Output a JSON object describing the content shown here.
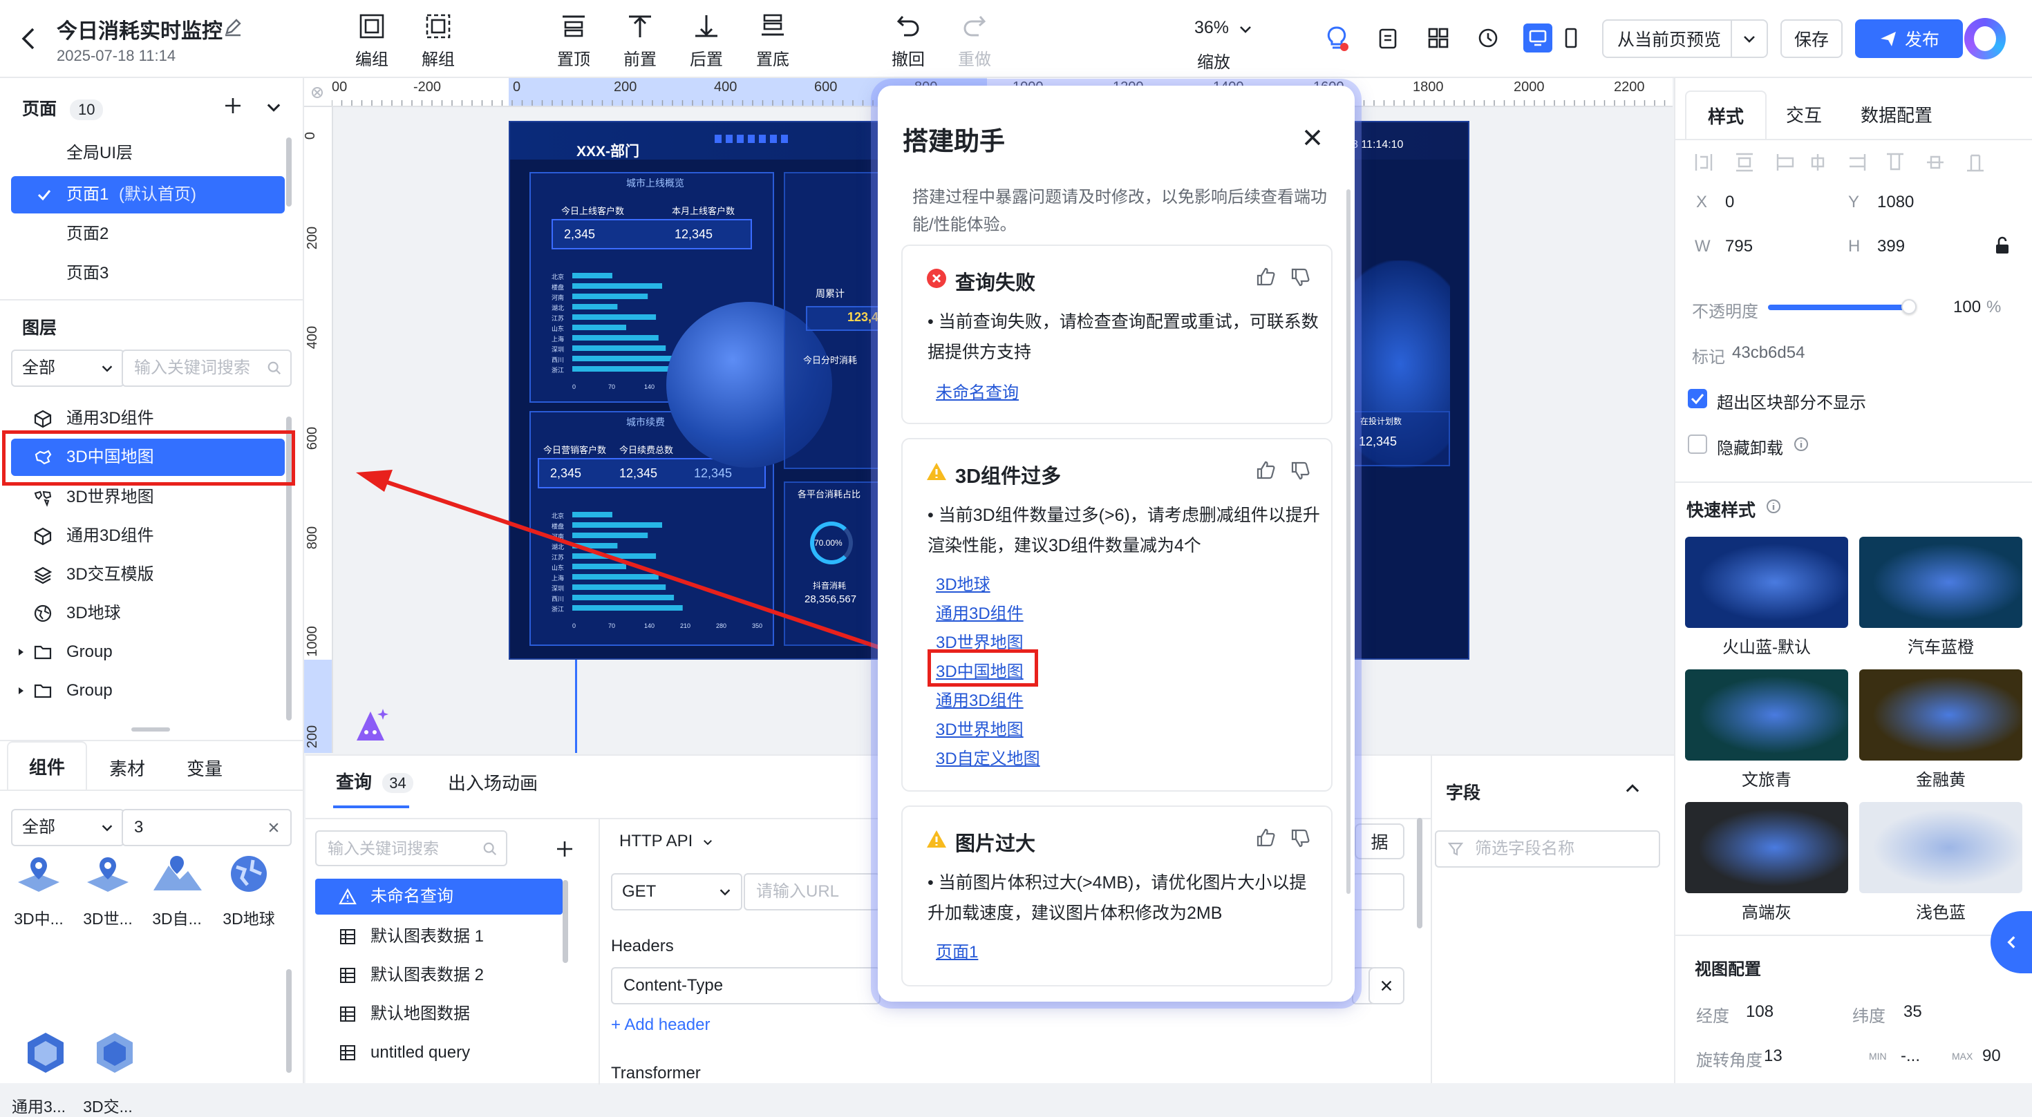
{
  "header": {
    "title": "今日消耗实时监控",
    "timestamp": "2025-07-18 11:14",
    "toolbar": [
      {
        "id": "group",
        "label": "编组"
      },
      {
        "id": "ungroup",
        "label": "解组"
      },
      {
        "id": "top",
        "label": "置顶"
      },
      {
        "id": "forward",
        "label": "前置"
      },
      {
        "id": "backward",
        "label": "后置"
      },
      {
        "id": "bottom",
        "label": "置底"
      },
      {
        "id": "undo",
        "label": "撤回"
      },
      {
        "id": "redo",
        "label": "重做"
      }
    ],
    "zoom": {
      "value": "36%",
      "label": "缩放"
    },
    "preview_label": "从当前页预览",
    "save_label": "保存",
    "publish_label": "发布"
  },
  "pages": {
    "title": "页面",
    "count": "10",
    "items": [
      {
        "label": "全局UI层"
      },
      {
        "label": "页面1",
        "suffix": "(默认首页)"
      },
      {
        "label": "页面2"
      },
      {
        "label": "页面3"
      }
    ]
  },
  "layers": {
    "title": "图层",
    "filter": "全部",
    "search_placeholder": "输入关键词搜索",
    "items": [
      {
        "label": "通用3D组件",
        "icon": "cube-icon"
      },
      {
        "label": "3D中国地图",
        "icon": "china-map-icon"
      },
      {
        "label": "3D世界地图",
        "icon": "world-map-icon"
      },
      {
        "label": "通用3D组件",
        "icon": "cube-icon"
      },
      {
        "label": "3D交互模版",
        "icon": "layers-icon"
      },
      {
        "label": "3D地球",
        "icon": "globe-icon"
      },
      {
        "label": "Group",
        "icon": "folder-icon"
      },
      {
        "label": "Group",
        "icon": "folder-icon"
      }
    ]
  },
  "bottom_tabs": {
    "components": "组件",
    "assets": "素材",
    "variables": "变量",
    "filter": "全部",
    "search_value": "3",
    "items": [
      {
        "label": "3D中..."
      },
      {
        "label": "3D世..."
      },
      {
        "label": "3D自..."
      },
      {
        "label": "3D地球"
      },
      {
        "label": "通用3..."
      },
      {
        "label": "3D交..."
      }
    ]
  },
  "rulers": {
    "h": [
      "-200",
      "0",
      "200",
      "400",
      "600",
      "800",
      "1000",
      "1200",
      "1400",
      "1600",
      "1800",
      "2000",
      "2200"
    ],
    "h_first": "00",
    "v": [
      "0",
      "200",
      "400",
      "600",
      "800",
      "1000",
      "200"
    ]
  },
  "dashboard": {
    "dept": "XXX-部门",
    "time": "8 11:14:10",
    "panel1_title": "城市上线概览",
    "today_new": "今日上线客户数",
    "month_new": "本月上线客户数",
    "today_val": "2,345",
    "month_val": "12,345",
    "panel2_title": "城市续费",
    "p2_a": "今日营销客户数",
    "p2_b": "今日续费总数",
    "p2_v1": "2,345",
    "p2_v2": "12,345",
    "p2_v3": "12,345",
    "week": "周累计",
    "week_val": "123,45",
    "minute": "今日分时消耗",
    "share": "各平台消耗占比",
    "pct": "70.00%",
    "douyin": "抖音消耗",
    "douyin_val": "28,356,567",
    "invest": "在投计划数",
    "invest_val": "12,345",
    "cities": [
      "北京",
      "楼盘",
      "河南",
      "湖北",
      "江苏",
      "山东",
      "上海",
      "深圳",
      "西川",
      "浙江"
    ],
    "bar_values": [
      78,
      175,
      147,
      88,
      163,
      105,
      168,
      182,
      198,
      215
    ],
    "x_ticks": [
      "0",
      "70",
      "140",
      "210",
      "280",
      "350"
    ]
  },
  "helper": {
    "title": "搭建助手",
    "intro": "搭建过程中暴露问题请及时修改，以免影响后续查看端功能/性能体验。",
    "cards": [
      {
        "title": "查询失败",
        "text": "当前查询失败，请检查查询配置或重试，可联系数据提供方支持",
        "links": [
          "未命名查询"
        ]
      },
      {
        "title": "3D组件过多",
        "text": "当前3D组件数量过多(>6)，请考虑删减组件以提升渲染性能，建议3D组件数量减为4个",
        "links": [
          "3D地球",
          "通用3D组件",
          "3D世界地图",
          "3D中国地图",
          "通用3D组件",
          "3D世界地图",
          "3D自定义地图"
        ]
      },
      {
        "title": "图片过大",
        "text": "当前图片体积过大(>4MB)，请优化图片大小以提升加载速度，建议图片体积修改为2MB",
        "links": [
          "页面1"
        ]
      }
    ]
  },
  "query": {
    "tab_label": "查询",
    "tab_count": "34",
    "anim_label": "出入场动画",
    "search_placeholder": "输入关键词搜索",
    "items": [
      {
        "label": "未命名查询",
        "icon": "warning-icon"
      },
      {
        "label": "默认图表数据 1",
        "icon": "table-icon"
      },
      {
        "label": "默认图表数据 2",
        "icon": "table-icon"
      },
      {
        "label": "默认地图数据",
        "icon": "table-icon"
      },
      {
        "label": "untitled query",
        "icon": "table-icon"
      }
    ],
    "api_type": "HTTP API",
    "method": "GET",
    "url_placeholder": "请输入URL",
    "headers_label": "Headers",
    "header_key": "Content-Type",
    "add_header": "+ Add header",
    "transformer": "Transformer",
    "fetch_partial": "据",
    "fields_label": "字段",
    "fields_placeholder": "筛选字段名称"
  },
  "right": {
    "tabs": [
      "样式",
      "交互",
      "数据配置"
    ],
    "x_label": "X",
    "x_val": "0",
    "y_label": "Y",
    "y_val": "1080",
    "w_label": "W",
    "w_val": "795",
    "h_label": "H",
    "h_val": "399",
    "opacity_label": "不透明度",
    "opacity_val": "100",
    "opacity_unit": "%",
    "opacity_level": 0.97,
    "mark_label": "标记",
    "mark_val": "43cb6d54",
    "overflow_label": "超出区块部分不显示",
    "hide_label": "隐藏卸载",
    "quick_label": "快速样式",
    "styles": [
      {
        "label": "火山蓝-默认",
        "color": "#0e2f7a"
      },
      {
        "label": "汽车蓝橙",
        "color": "#0b3a5a"
      },
      {
        "label": "文旅青",
        "color": "#0d3f44"
      },
      {
        "label": "金融黄",
        "color": "#3a2f12"
      },
      {
        "label": "高端灰",
        "color": "#25282c"
      },
      {
        "label": "浅色蓝",
        "color": "#e3e8f0"
      }
    ],
    "view_label": "视图配置",
    "lng_label": "经度",
    "lng_val": "108",
    "lat_label": "纬度",
    "lat_val": "35",
    "rot_label": "旋转角度",
    "rot_val": "13",
    "min_label": "MIN",
    "min_val": "-...",
    "max_label": "MAX",
    "max_val": "90"
  }
}
